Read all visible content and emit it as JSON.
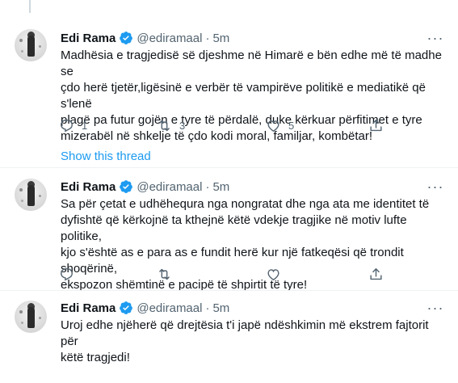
{
  "tweets": [
    {
      "name": "Edi Rama",
      "handle": "@ediramaal",
      "separator": "·",
      "time": "5m",
      "text_lines": [
        "Madhësia e tragjedisë së djeshme në Himarë e bën edhe më të madhe se",
        "çdo herë tjetër,ligësinë e verbër të vampirëve politikë e mediatikë që s'lenë",
        "plagë pa futur gojën e tyre të përdalë, duke kërkuar përfitimet e tyre",
        "mizerabël në shkelje të çdo kodi moral, familjar, kombëtar!"
      ],
      "reply_count": "1",
      "retweet_count": "3",
      "like_count": "5"
    },
    {
      "name": "Edi Rama",
      "handle": "@ediramaal",
      "separator": "·",
      "time": "5m",
      "text_lines": [
        "Sa për çetat e udhëhequra nga nongratat dhe nga ata me identitet të",
        "dyfishtë që kërkojnë ta kthejnë  këtë vdekje tragjike në motiv lufte politike,",
        "kjo s'është as e para as e fundit herë kur një fatkeqësi që trondit shoqërinë,",
        "ekspozon shëmtinë e pacipë të shpirtit të tyre!"
      ],
      "reply_count": "",
      "retweet_count": "",
      "like_count": ""
    },
    {
      "name": "Edi Rama",
      "handle": "@ediramaal",
      "separator": "·",
      "time": "5m",
      "text_lines": [
        "Uroj edhe njëherë që drejtësia t'i japë ndëshkimin më ekstrem fajtorit për",
        "këtë tragjedi!"
      ]
    }
  ],
  "show_thread_label": "Show this thread",
  "more_icon": "···",
  "colors": {
    "accent": "#1d9bf0",
    "muted": "#536471",
    "text": "#0f1419",
    "divider": "#eff3f4"
  },
  "icons": [
    "verified-badge-icon",
    "reply-icon",
    "retweet-icon",
    "like-icon",
    "share-icon",
    "more-icon"
  ]
}
